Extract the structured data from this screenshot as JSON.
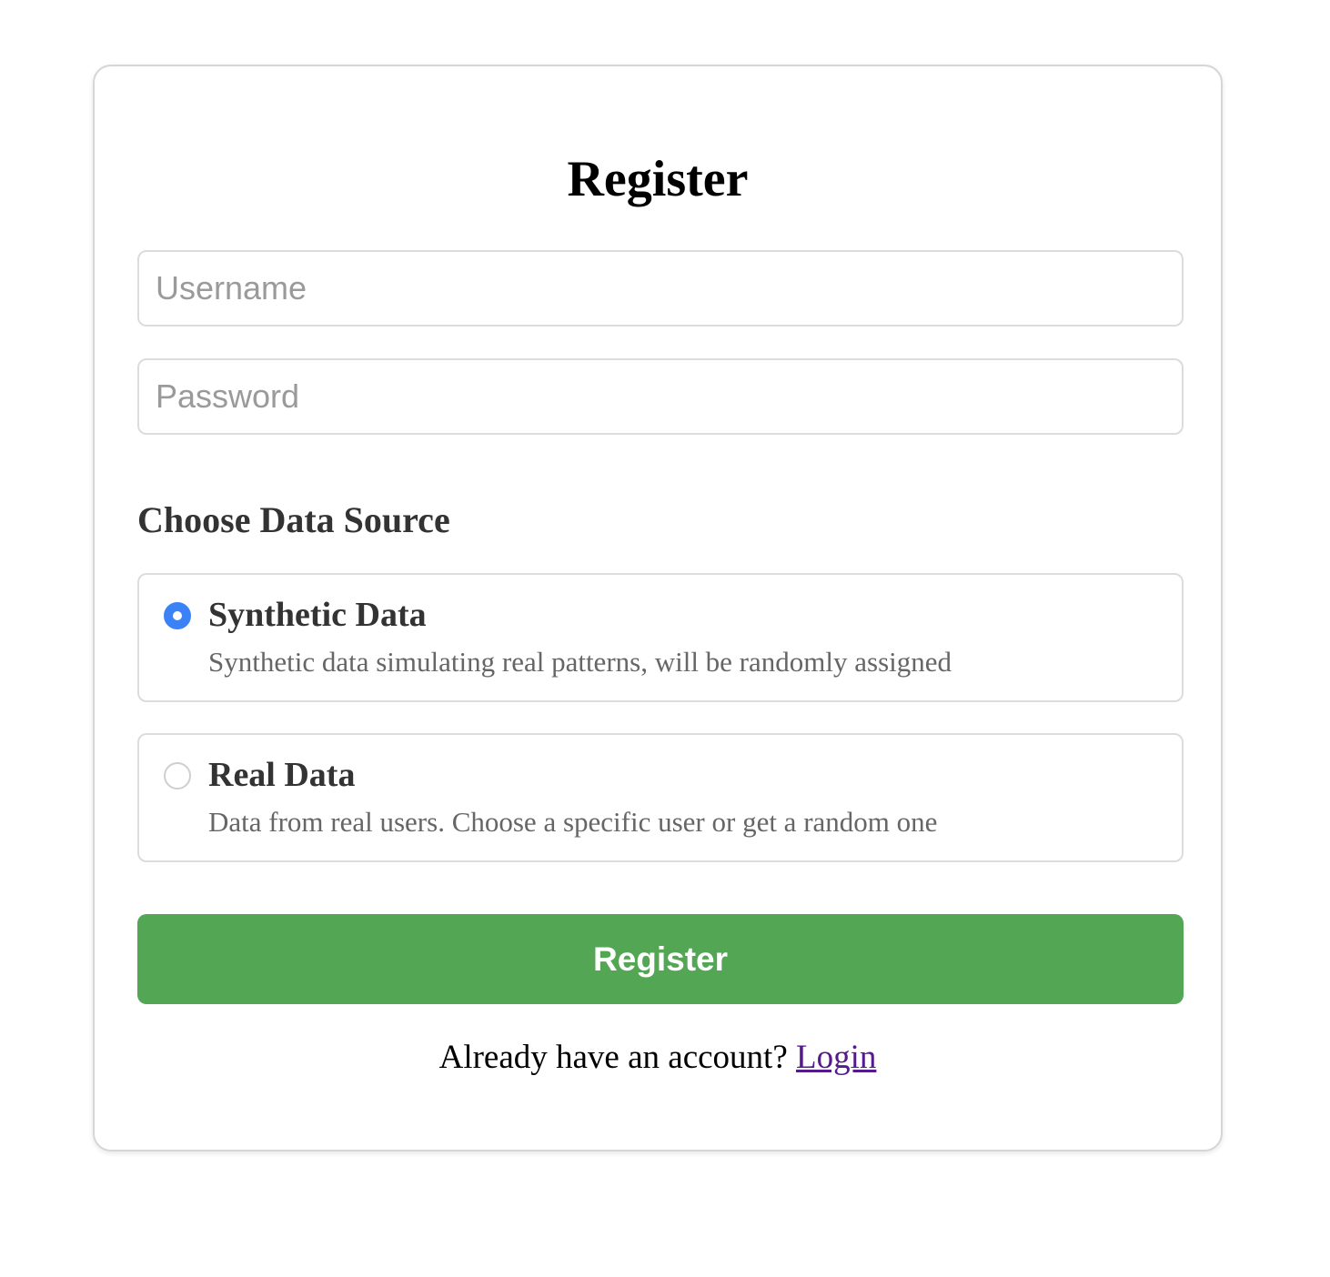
{
  "form": {
    "title": "Register",
    "username_placeholder": "Username",
    "password_placeholder": "Password",
    "section_heading": "Choose Data Source",
    "options": [
      {
        "label": "Synthetic Data",
        "description": "Synthetic data simulating real patterns, will be randomly assigned",
        "selected": true
      },
      {
        "label": "Real Data",
        "description": "Data from real users. Choose a specific user or get a random one",
        "selected": false
      }
    ],
    "submit_label": "Register",
    "footer_text": "Already have an account?",
    "login_link_label": "Login"
  },
  "colors": {
    "button": "#53a653",
    "radio_selected": "#3b82f6",
    "link": "#551a8b"
  }
}
